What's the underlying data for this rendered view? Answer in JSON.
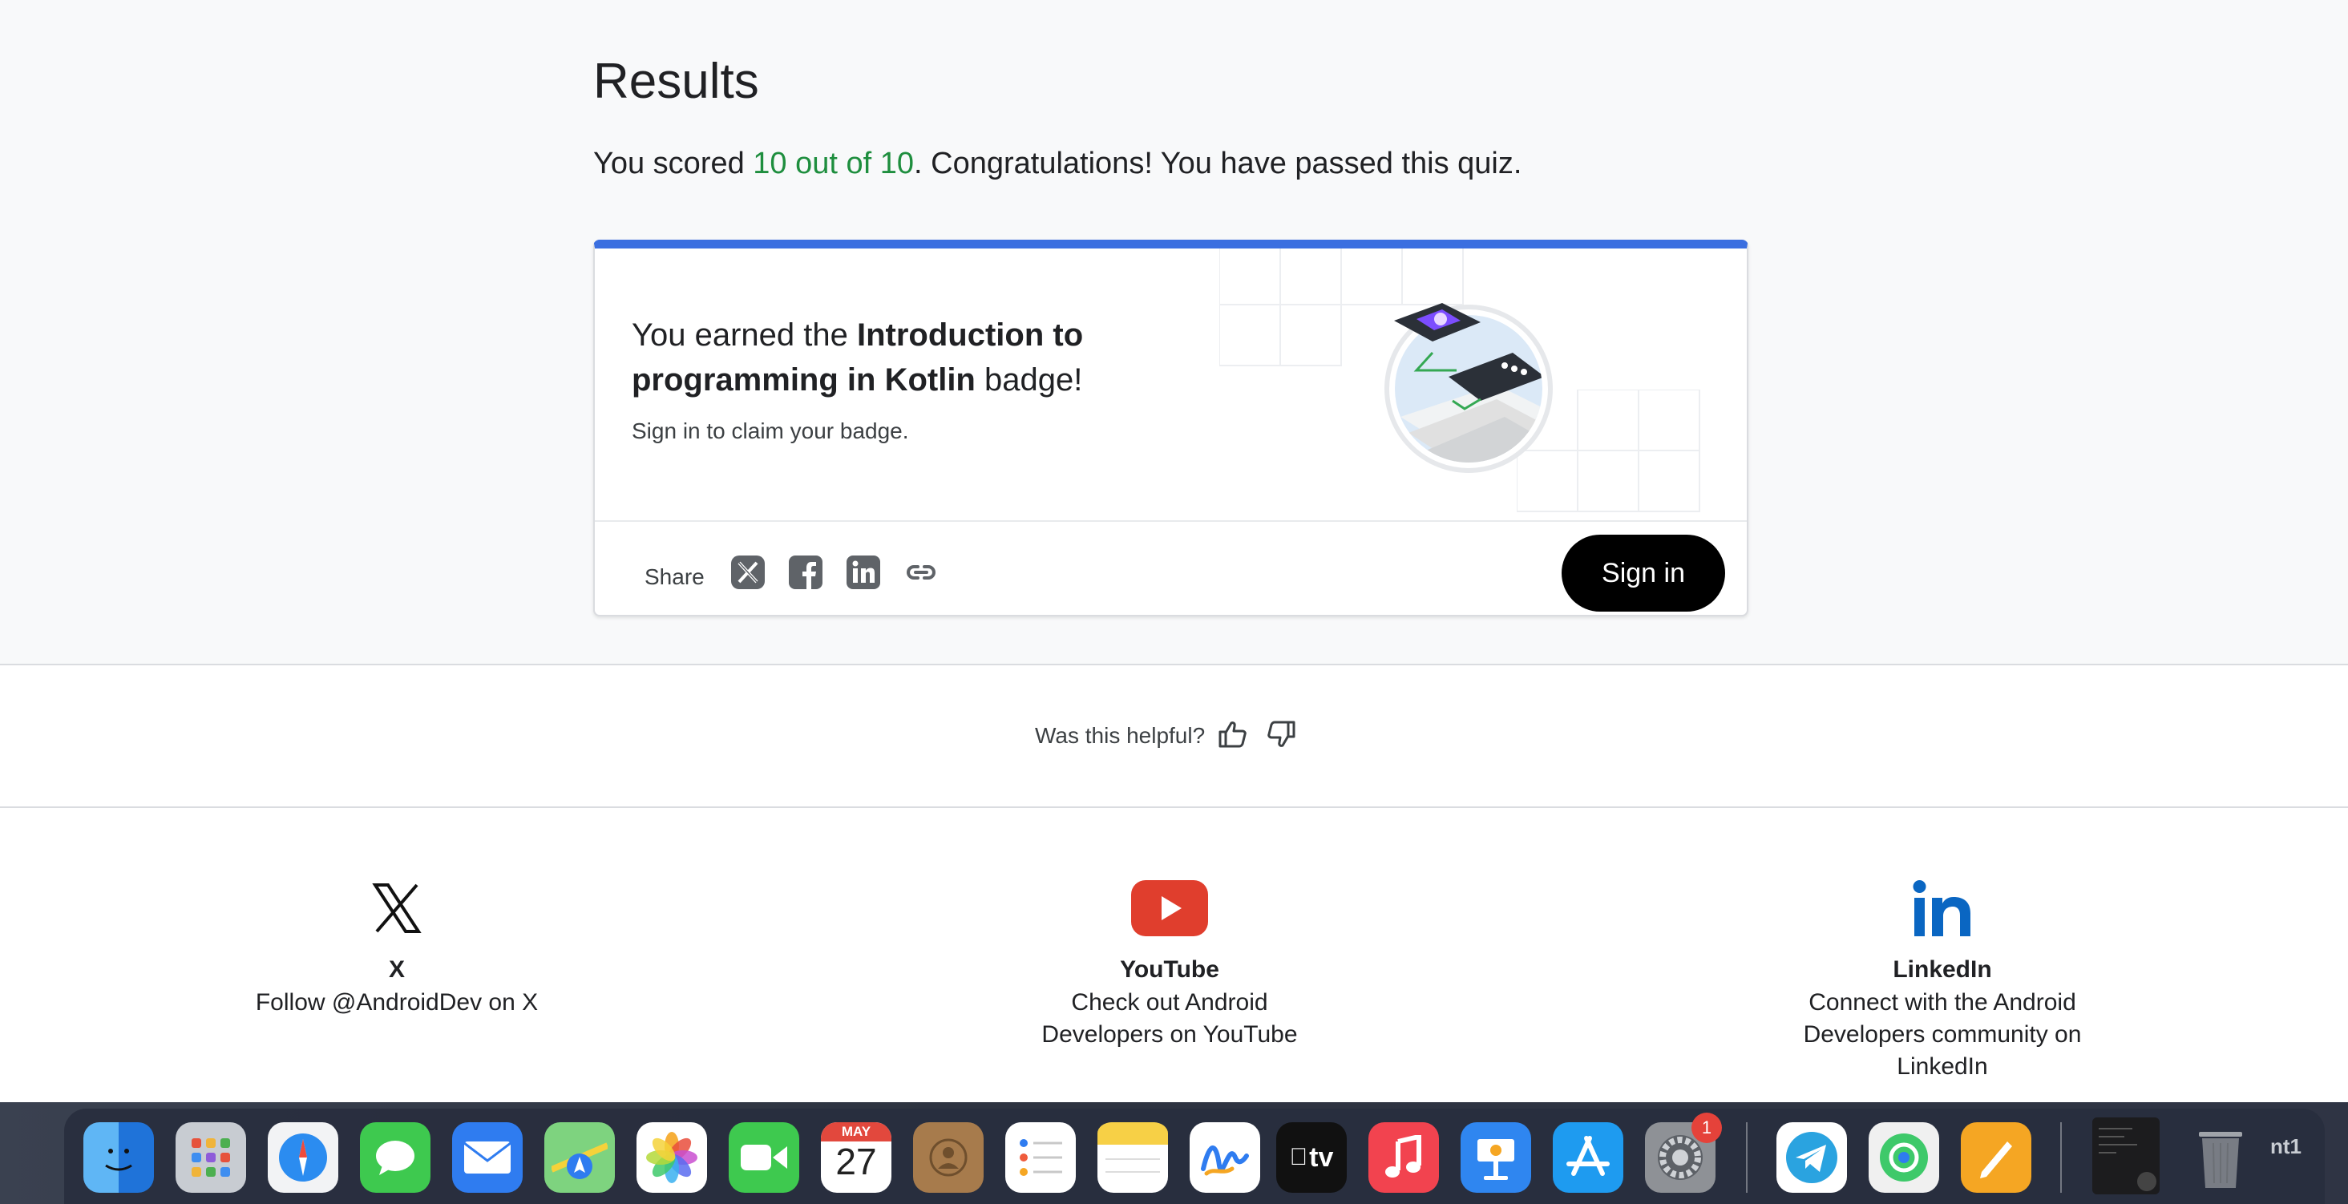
{
  "results": {
    "title": "Results",
    "score_prefix": "You scored ",
    "score_highlight": "10 out of 10",
    "score_suffix": ". Congratulations! You have passed this quiz."
  },
  "badge": {
    "text_prefix": "You earned the ",
    "badge_name": "Introduction to programming in Kotlin",
    "text_suffix": " badge!",
    "subtext": "Sign in to claim your badge.",
    "share_label": "Share",
    "sign_in_label": "Sign in"
  },
  "feedback": {
    "question": "Was this helpful?"
  },
  "social": [
    {
      "name": "X",
      "description": "Follow @AndroidDev on X"
    },
    {
      "name": "YouTube",
      "description": "Check out Android Developers on YouTube"
    },
    {
      "name": "LinkedIn",
      "description": "Connect with the Android Developers community on LinkedIn"
    }
  ],
  "dock": {
    "calendar_month": "MAY",
    "calendar_day": "27",
    "tv_label": "tv",
    "settings_badge": "1",
    "partial_text": "nt1"
  },
  "colors": {
    "score_green": "#1e8e3e",
    "card_accent": "#3b6fe0",
    "youtube_red": "#e03e2d",
    "linkedin_blue": "#0a66c2"
  }
}
